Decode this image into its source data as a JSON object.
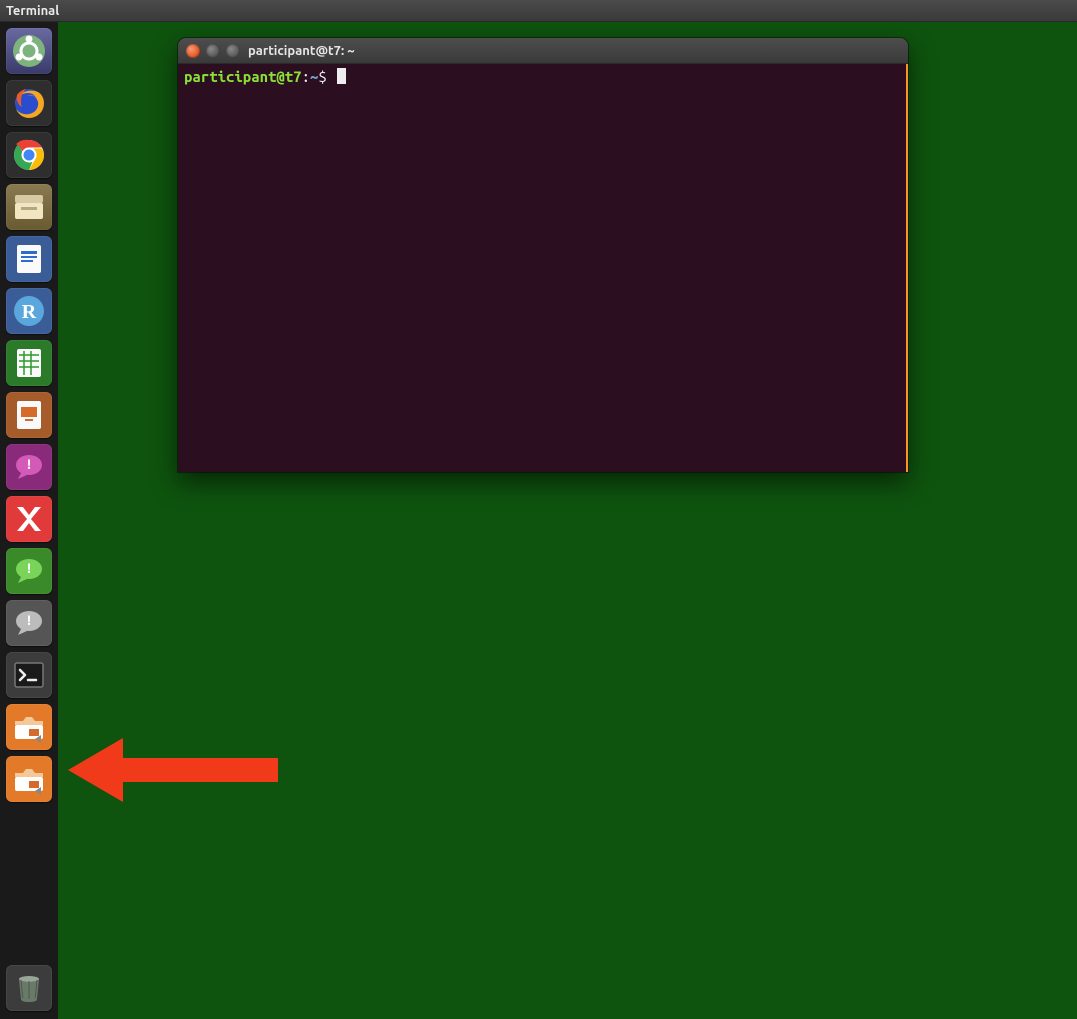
{
  "menubar": {
    "app_name": "Terminal"
  },
  "launcher": {
    "items": [
      {
        "name": "ubuntu-dash",
        "label": "Dash"
      },
      {
        "name": "firefox",
        "label": "Firefox"
      },
      {
        "name": "chrome",
        "label": "Google Chrome"
      },
      {
        "name": "files",
        "label": "Files"
      },
      {
        "name": "writer",
        "label": "LibreOffice Writer"
      },
      {
        "name": "rstudio",
        "label": "RStudio"
      },
      {
        "name": "calc",
        "label": "LibreOffice Calc"
      },
      {
        "name": "impress",
        "label": "LibreOffice Impress"
      },
      {
        "name": "chat-purple",
        "label": "Messaging (purple)"
      },
      {
        "name": "xmind",
        "label": "XMind"
      },
      {
        "name": "chat-green",
        "label": "Messaging (green)"
      },
      {
        "name": "chat-grey",
        "label": "Messaging (grey)"
      },
      {
        "name": "terminal",
        "label": "Terminal"
      },
      {
        "name": "screenshot-1",
        "label": "Screenshot tool"
      },
      {
        "name": "screenshot-2",
        "label": "Screenshot tool"
      }
    ],
    "trash": {
      "name": "trash",
      "label": "Trash"
    },
    "active": "terminal",
    "active_index": 12
  },
  "terminal_window": {
    "title": "participant@t7: ~",
    "prompt": {
      "user_host": "participant@t7",
      "separator": ":",
      "cwd": "~",
      "symbol": "$"
    },
    "buffer": ""
  },
  "annotation": {
    "arrow_color": "#f13a1a",
    "points_to": "terminal launcher icon"
  }
}
